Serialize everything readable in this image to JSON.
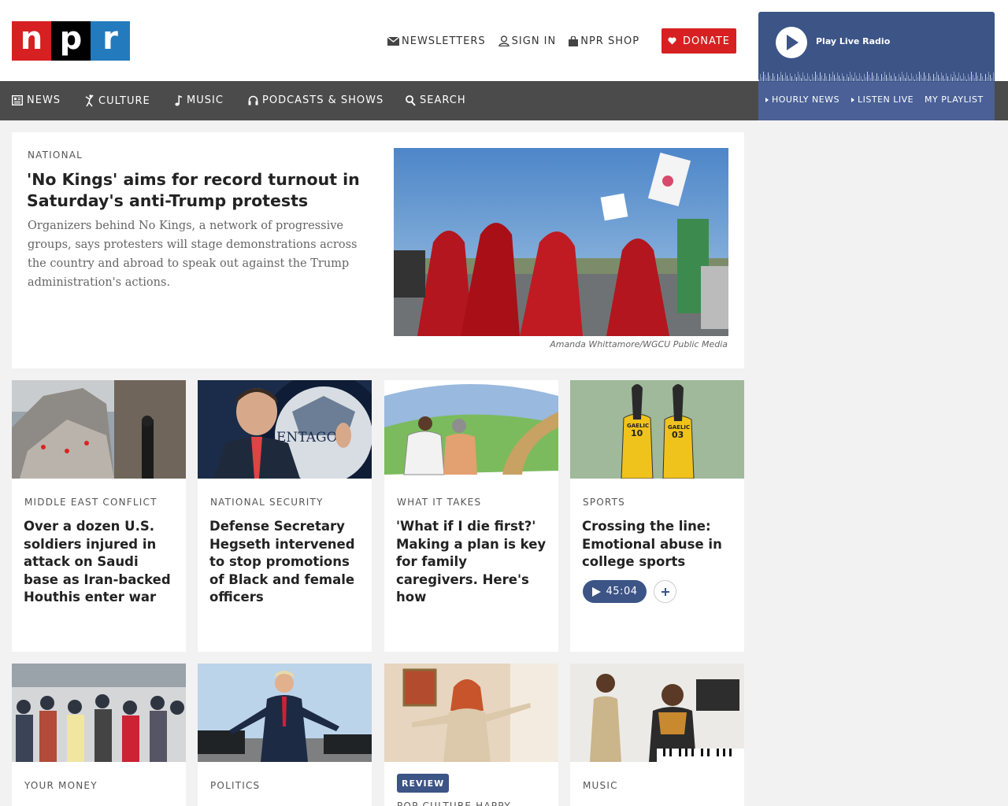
{
  "header": {
    "logo": {
      "letters": [
        "n",
        "p",
        "r"
      ],
      "colors": [
        "#d62021",
        "#000000",
        "#237bbd"
      ]
    },
    "util_nav": [
      {
        "label": "NEWSLETTERS",
        "icon": "envelope-icon"
      },
      {
        "label": "SIGN IN",
        "icon": "user-icon"
      },
      {
        "label": "NPR SHOP",
        "icon": "shopping-bag-icon"
      }
    ],
    "donate": {
      "label": "DONATE",
      "icon": "heart-icon",
      "color": "#d62021"
    }
  },
  "main_nav": [
    {
      "label": "NEWS",
      "icon": "newspaper-icon"
    },
    {
      "label": "CULTURE",
      "icon": "dancer-icon"
    },
    {
      "label": "MUSIC",
      "icon": "music-note-icon"
    },
    {
      "label": "PODCASTS & SHOWS",
      "icon": "headphones-icon"
    },
    {
      "label": "SEARCH",
      "icon": "search-icon"
    }
  ],
  "player": {
    "title": "Play Live Radio",
    "links": [
      {
        "label": "HOURLY NEWS",
        "icon": "triangle-right-icon"
      },
      {
        "label": "LISTEN LIVE",
        "icon": "triangle-right-icon"
      },
      {
        "label": "MY PLAYLIST"
      }
    ],
    "color": "#3c5486"
  },
  "featured": {
    "slug": "NATIONAL",
    "title": "'No Kings' aims for record turnout in Saturday's anti-Trump protests",
    "teaser": "Organizers behind No Kings, a network of progressive groups, says protesters will stage demonstrations across the country and abroad to speak out against the Trump administration's actions.",
    "credit": "Amanda Whittamore/WGCU Public Media"
  },
  "cards_row1": [
    {
      "slug": "MIDDLE EAST CONFLICT",
      "title": "Over a dozen U.S. soldiers injured in attack on Saudi base as Iran-backed Houthis enter war"
    },
    {
      "slug": "NATIONAL SECURITY",
      "title": "Defense Secretary Hegseth intervened to stop promotions of Black and female officers",
      "image_text": "ENTAGON"
    },
    {
      "slug": "WHAT IT TAKES",
      "title": "'What if I die first?' Making a plan is key for family caregivers. Here's how"
    },
    {
      "slug": "SPORTS",
      "title": "Crossing the line: Emotional abuse in college sports",
      "audio_duration": "45:04",
      "jerseys": [
        {
          "team": "GAELIC",
          "number": "10"
        },
        {
          "team": "GAELIC",
          "number": "03"
        }
      ]
    }
  ],
  "cards_row2": [
    {
      "slug": "YOUR MONEY"
    },
    {
      "slug": "POLITICS"
    },
    {
      "badge": "REVIEW",
      "slug": "POP CULTURE HAPPY"
    },
    {
      "slug": "MUSIC"
    }
  ]
}
